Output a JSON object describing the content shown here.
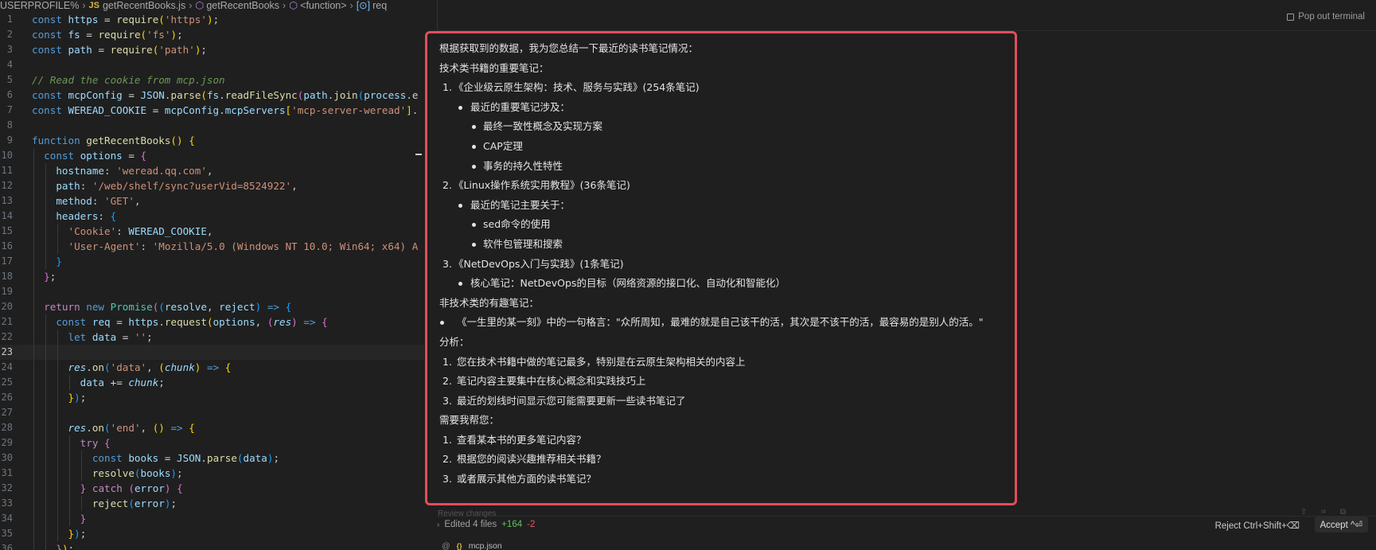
{
  "breadcrumb": {
    "part1": "USERPROFILE%",
    "file_badge": "JS",
    "file": "getRecentBooks.js",
    "func": "getRecentBooks",
    "anon": "<function>",
    "var": "req"
  },
  "code_comment": "// Read the cookie from mcp.json",
  "strings": {
    "https": "'https'",
    "fs": "'fs'",
    "path": "'path'",
    "mcp_server": "'mcp-server-weread'",
    "hostname": "'weread.qq.com'",
    "path_val": "'/web/shelf/sync?userVid=8524922'",
    "method": "'GET'",
    "cookie_key": "'Cookie'",
    "ua_key": "'User-Agent'",
    "ua_val": "'Mozilla/5.0 (Windows NT 10.0; Win64; x64) A",
    "empty": "''",
    "data_evt": "'data'",
    "end_evt": "'end'"
  },
  "line_numbers": [
    "1",
    "2",
    "3",
    "4",
    "5",
    "6",
    "7",
    "8",
    "9",
    "10",
    "11",
    "12",
    "13",
    "14",
    "15",
    "16",
    "17",
    "18",
    "19",
    "20",
    "21",
    "22",
    "23",
    "24",
    "25",
    "26",
    "27",
    "28",
    "29",
    "30",
    "31",
    "32",
    "33",
    "34",
    "35",
    "36"
  ],
  "popout": "Pop out terminal",
  "summary": {
    "intro": "根据获取到的数据，我为您总结一下最近的读书笔记情况：",
    "tech_heading": "技术类书籍的重要笔记：",
    "book1_num": "1.",
    "book1": "《企业级云原生架构：技术、服务与实践》(254条笔记)",
    "book1_sub": "最近的重要笔记涉及：",
    "book1_items": [
      "最终一致性概念及实现方案",
      "CAP定理",
      "事务的持久性特性"
    ],
    "book2_num": "2.",
    "book2": "《Linux操作系统实用教程》(36条笔记)",
    "book2_sub": "最近的笔记主要关于：",
    "book2_items": [
      "sed命令的使用",
      "软件包管理和搜索"
    ],
    "book3_num": "3.",
    "book3": "《NetDevOps入门与实践》(1条笔记)",
    "book3_sub": "核心笔记：NetDevOps的目标（网络资源的接口化、自动化和智能化）",
    "nontech_heading": "非技术类的有趣笔记：",
    "nontech_item": "《一生里的某一刻》中的一句格言：\"众所周知，最难的就是自己该干的活，其次是不该干的活，最容易的是别人的活。\"",
    "analysis_heading": "分析：",
    "analysis_items": [
      "您在技术书籍中做的笔记最多，特别是在云原生架构相关的内容上",
      "笔记内容主要集中在核心概念和实践技巧上",
      "最近的划线时间显示您可能需要更新一些读书笔记了"
    ],
    "help_heading": "需要我帮您：",
    "help_items": [
      "查看某本书的更多笔记内容？",
      "根据您的阅读兴趣推荐相关书籍？",
      "或者展示其他方面的读书笔记？"
    ]
  },
  "faint_label": "Review changes",
  "bottom": {
    "edited": "Edited 4 files",
    "added": "+164",
    "removed": "-2",
    "reject": "Reject Ctrl+Shift+⌫",
    "accept": "Accept ^⏎"
  },
  "file_tab": {
    "at": "@",
    "badge": "{}",
    "name": "mcp.json"
  }
}
